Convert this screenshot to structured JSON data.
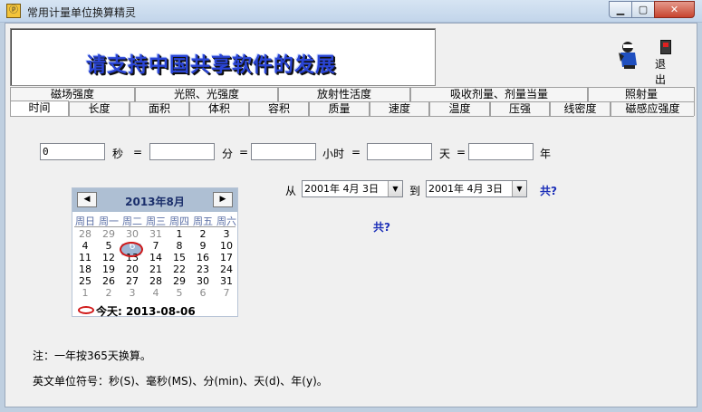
{
  "window": {
    "title": "常用计量单位换算精灵",
    "buttons": {
      "minimize": "▁",
      "maximize": "▢",
      "close": "✕"
    }
  },
  "banner": {
    "text": "请支持中国共享软件的发展"
  },
  "exit": {
    "label": "退出"
  },
  "tabs": {
    "row1": [
      "磁场强度",
      "光照、光强度",
      "放射性活度",
      "吸收剂量、剂量当量",
      "照射量"
    ],
    "row2": [
      "时间",
      "长度",
      "面积",
      "体积",
      "容积",
      "质量",
      "速度",
      "温度",
      "压强",
      "线密度",
      "磁感应强度"
    ],
    "active": "时间"
  },
  "converter": {
    "seconds_value": "0",
    "seconds_unit": "秒",
    "minutes_value": "",
    "minutes_unit": "分",
    "hours_value": "",
    "hours_unit": "小时",
    "days_value": "",
    "days_unit": "天",
    "years_value": "",
    "years_unit": "年",
    "eq": "="
  },
  "daterange": {
    "from_label": "从",
    "from_value": "2001年 4月 3日",
    "to_label": "到",
    "to_value": "2001年 4月 3日",
    "total_label": "共?",
    "result_label": "共?"
  },
  "calendar": {
    "title": "2013年8月",
    "prev": "◀",
    "next": "▶",
    "weekdays": [
      "周日",
      "周一",
      "周二",
      "周三",
      "周四",
      "周五",
      "周六"
    ],
    "weeks": [
      [
        "28",
        "29",
        "30",
        "31",
        "1",
        "2",
        "3"
      ],
      [
        "4",
        "5",
        "6",
        "7",
        "8",
        "9",
        "10"
      ],
      [
        "11",
        "12",
        "13",
        "14",
        "15",
        "16",
        "17"
      ],
      [
        "18",
        "19",
        "20",
        "21",
        "22",
        "23",
        "24"
      ],
      [
        "25",
        "26",
        "27",
        "28",
        "29",
        "30",
        "31"
      ],
      [
        "1",
        "2",
        "3",
        "4",
        "5",
        "6",
        "7"
      ]
    ],
    "selected_day": "6",
    "today_label": "今天: 2013-08-06"
  },
  "notes": {
    "note1": "注：一年按365天换算。",
    "note2": "英文单位符号：秒(S)、毫秒(MS)、分(min)、天(d)、年(y)。"
  }
}
